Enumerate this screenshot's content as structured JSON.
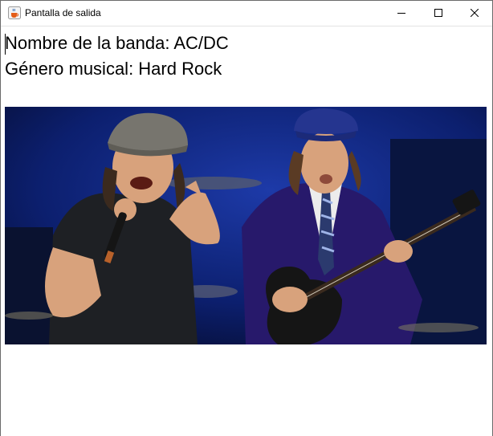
{
  "window": {
    "title": "Pantalla de salida"
  },
  "icons": {
    "app": "java-coffee-cup-icon",
    "minimize": "minimize-icon",
    "maximize": "maximize-icon",
    "close": "close-icon"
  },
  "content": {
    "band_line": "Nombre de la banda: AC/DC",
    "genre_line": "Género musical: Hard Rock"
  },
  "colors": {
    "stage_blue": "#0c1f6e",
    "cap_blue": "#25358f",
    "cap_grey": "#77756e",
    "jacket_blue": "#27196b",
    "skin": "#d8a27c",
    "shirt_dark": "#1e2024"
  }
}
